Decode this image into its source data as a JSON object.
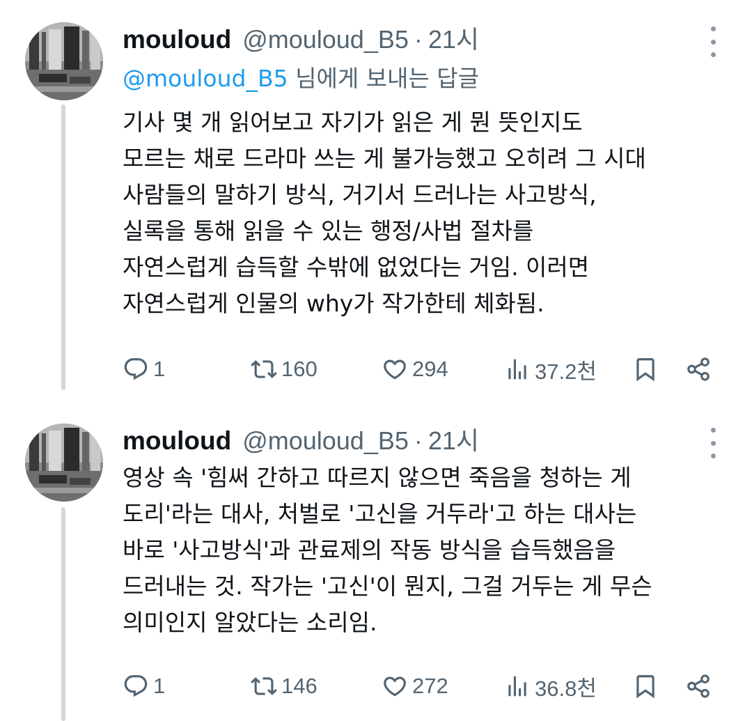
{
  "tweets": [
    {
      "name": "mouloud",
      "handle": "@mouloud_B5",
      "separator": "·",
      "time": "21시",
      "replying_mention": "@mouloud_B5",
      "replying_suffix": " 님에게 보내는 답글",
      "text": "기사 몇 개 읽어보고 자기가 읽은 게 뭔 뜻인지도\n모르는 채로 드라마 쓰는 게 불가능했고 오히려 그 시대\n사람들의 말하기 방식, 거기서 드러나는 사고방식,\n실록을 통해 읽을 수 있는 행정/사법 절차를\n자연스럽게 습득할 수밖에 없었다는 거임. 이러면\n자연스럽게 인물의 why가 작가한테 체화됨.",
      "replies": "1",
      "retweets": "160",
      "likes": "294",
      "views": "37.2천"
    },
    {
      "name": "mouloud",
      "handle": "@mouloud_B5",
      "separator": "·",
      "time": "21시",
      "text": "영상 속 '힘써 간하고 따르지 않으면 죽음을 청하는 게\n도리'라는 대사, 처벌로 '고신을 거두라'고 하는 대사는\n바로 '사고방식'과 관료제의 작동 방식을 습득했음을\n드러내는 것. 작가는 '고신'이 뭔지, 그걸 거두는 게 무슨\n의미인지 알았다는 소리임.",
      "replies": "1",
      "retweets": "146",
      "likes": "272",
      "views": "36.8천"
    }
  ],
  "icons": [
    "reply-icon",
    "retweet-icon",
    "like-icon",
    "views-icon",
    "bookmark-icon",
    "share-icon",
    "more-icon"
  ]
}
